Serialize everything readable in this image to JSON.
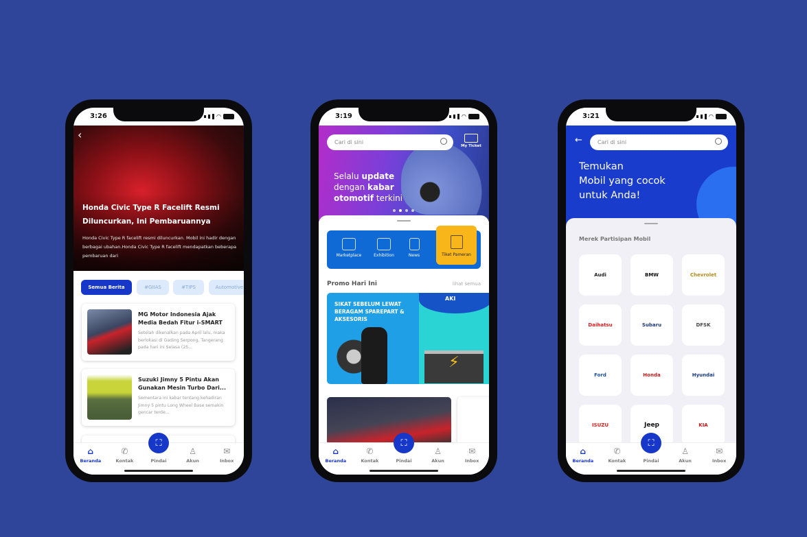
{
  "colors": {
    "background": "#2e4599",
    "accent": "#1637c7",
    "yellow": "#f9b61a"
  },
  "nav": {
    "items": [
      {
        "label": "Beranda",
        "icon": "home-icon"
      },
      {
        "label": "Kontak",
        "icon": "phone-icon"
      },
      {
        "label": "Pindai",
        "icon": "scan-icon"
      },
      {
        "label": "Akun",
        "icon": "user-icon"
      },
      {
        "label": "Inbox",
        "icon": "mail-icon"
      }
    ]
  },
  "phone1": {
    "time": "3:26",
    "hero": {
      "title": "Honda Civic Type R Facelift Resmi Diluncurkan, Ini Pembaruannya",
      "description": "Honda Civic Type R facelift resmi diluncurkan. Mobil ini hadir dengan berbagai ubahan.Honda Civic Type R facelift mendapatkan beberapa pembaruan dari"
    },
    "chips": [
      "Semua Berita",
      "#GIIAS",
      "#TIPS",
      "Automotive"
    ],
    "articles": [
      {
        "title": "MG Motor Indonesia Ajak Media Bedah Fitur i-SMART",
        "excerpt": "Setelah dikenalkan pada April lalu, maka berlokasi di Gading Serpong, Tangerang pada hari ini Selasa (25..."
      },
      {
        "title": "Suzuki Jimny 5 Pintu Akan Gunakan Mesin Turbo Dari...",
        "excerpt": "Sementara ini kabar tentang kehadiran Jimny 5 pintu Long Wheel Base semakin gencar terde..."
      }
    ]
  },
  "phone2": {
    "time": "3:19",
    "search_placeholder": "Cari di sini",
    "my_ticket": "My Ticket",
    "banner": {
      "line1a": "Selalu ",
      "line1b": "update",
      "line2a": "dengan ",
      "line2b": "kabar",
      "line3a": "otomotif",
      "line3b": " terkini"
    },
    "menu": [
      "Marketplace",
      "Exhibition",
      "News",
      "Tiket Pameran"
    ],
    "promo_title": "Promo Hari Ini",
    "promo_link": "lihat semua",
    "promo_banner": {
      "headline": "SIKAT SEBELUM LEWAT BERAGAM SPAREPART & AKSESORIS",
      "tag": "AKI"
    }
  },
  "phone3": {
    "time": "3:21",
    "search_placeholder": "Cari di sini",
    "headline": [
      "Temukan",
      "Mobil yang cocok",
      "untuk Anda!"
    ],
    "section_title": "Merek Partisipan Mobil",
    "brands": [
      "Audi",
      "BMW",
      "Chevrolet",
      "Daihatsu",
      "Subaru",
      "DFSK",
      "Ford",
      "Honda",
      "Hyundai",
      "ISUZU",
      "Jeep",
      "KIA"
    ]
  }
}
